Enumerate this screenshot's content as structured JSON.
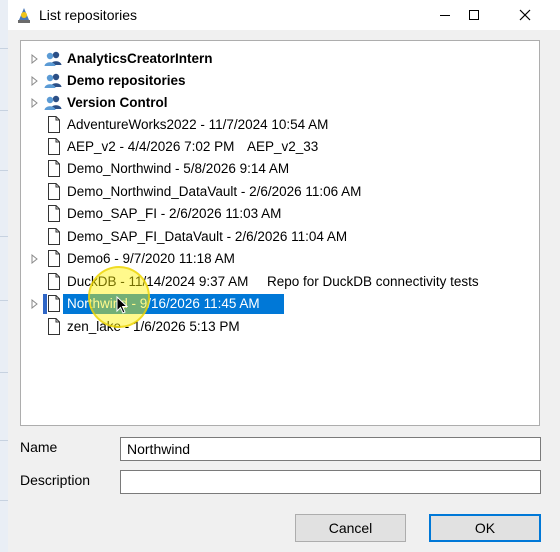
{
  "window": {
    "title": "List repositories",
    "minimize_icon": "minimize-icon",
    "maximize_icon": "maximize-icon",
    "close_icon": "close-icon"
  },
  "tree": {
    "groups": [
      {
        "label": "AnalyticsCreatorIntern",
        "icon": "users-icon"
      },
      {
        "label": "Demo repositories",
        "icon": "users-icon"
      },
      {
        "label": "Version Control",
        "icon": "users-icon"
      }
    ],
    "items": [
      {
        "label": "AdventureWorks2022 - 11/7/2024 10:54 AM",
        "description": ""
      },
      {
        "label": "AEP_v2 - 4/4/2026 7:02 PM",
        "description": "AEP_v2_33"
      },
      {
        "label": "Demo_Northwind - 5/8/2026 9:14 AM",
        "description": ""
      },
      {
        "label": "Demo_Northwind_DataVault - 2/6/2026 11:06 AM",
        "description": ""
      },
      {
        "label": "Demo_SAP_FI - 2/6/2026 11:03 AM",
        "description": ""
      },
      {
        "label": "Demo_SAP_FI_DataVault - 2/6/2026 11:04 AM",
        "description": ""
      },
      {
        "label": "Demo6 - 9/7/2020 11:18 AM",
        "description": ""
      },
      {
        "label": "DuckDB - 11/14/2024 9:37 AM",
        "description": "Repo for DuckDB connectivity tests"
      },
      {
        "label": "Northwind - 9/16/2026 11:45 AM",
        "description": "",
        "selected": true
      },
      {
        "label": "zen_lake - 1/6/2026 5:13 PM",
        "description": ""
      }
    ]
  },
  "form": {
    "name_label": "Name",
    "name_value": "Northwind",
    "description_label": "Description",
    "description_value": ""
  },
  "buttons": {
    "cancel": "Cancel",
    "ok": "OK"
  },
  "colors": {
    "selection": "#0078d7",
    "window_bg": "#f0f0f0",
    "cursor_highlight": "#fff200"
  }
}
